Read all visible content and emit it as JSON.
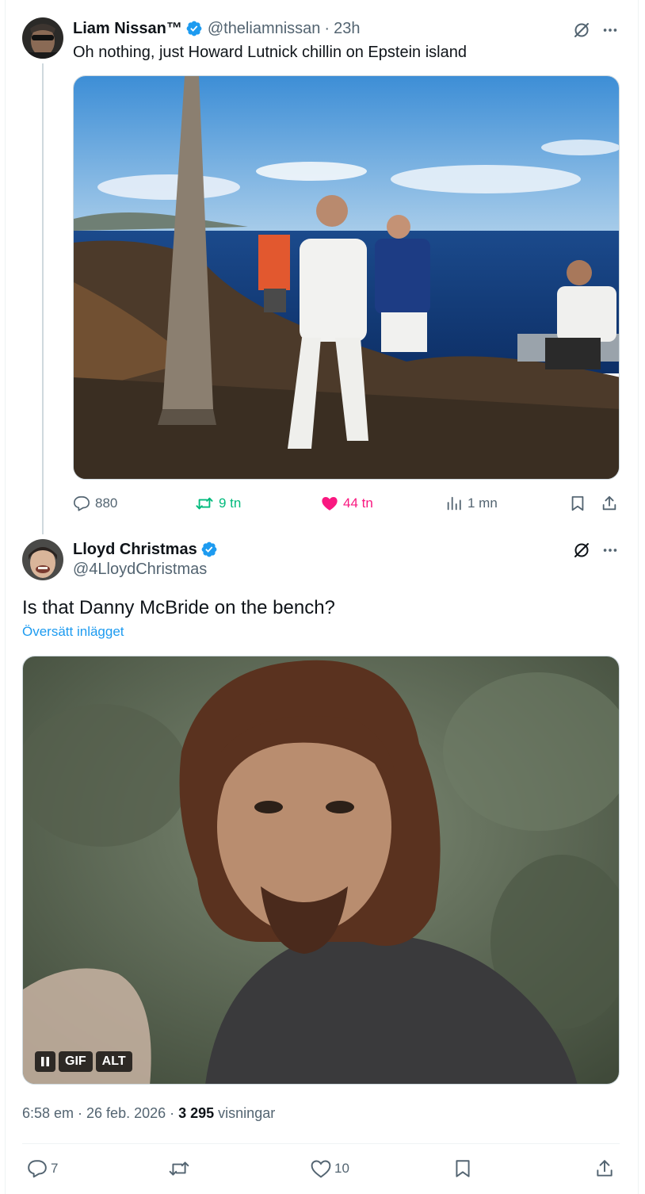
{
  "parent_tweet": {
    "author_name": "Liam Nissan™",
    "handle": "@theliamnissan",
    "separator": "·",
    "time": "23h",
    "text": "Oh nothing, just Howard Lutnick chillin on Epstein island",
    "media_description_icon": "photo",
    "stats": {
      "replies": "880",
      "retweets": "9 tn",
      "likes": "44 tn",
      "views": "1 mn"
    }
  },
  "main_tweet": {
    "author_name": "Lloyd Christmas",
    "handle": "@4LloydChristmas",
    "text": "Is that Danny McBride on the bench?",
    "translate_label": "Översätt inlägget",
    "gif_badges": {
      "gif": "GIF",
      "alt": "ALT"
    },
    "timestamp": "6:58 em · 26 feb. 2026 · ",
    "views_count": "3 295",
    "views_label": " visningar",
    "stats": {
      "replies": "7",
      "likes": "10"
    }
  },
  "colors": {
    "verified": "#1d9bf0",
    "retweet_active": "#00ba7c",
    "like_active": "#f91880",
    "link": "#1d9bf0",
    "secondary_text": "#536471"
  },
  "icons": [
    "verified-icon",
    "grok-icon",
    "more-icon",
    "reply-icon",
    "retweet-icon",
    "like-icon",
    "views-icon",
    "bookmark-icon",
    "share-icon",
    "pause-icon"
  ]
}
